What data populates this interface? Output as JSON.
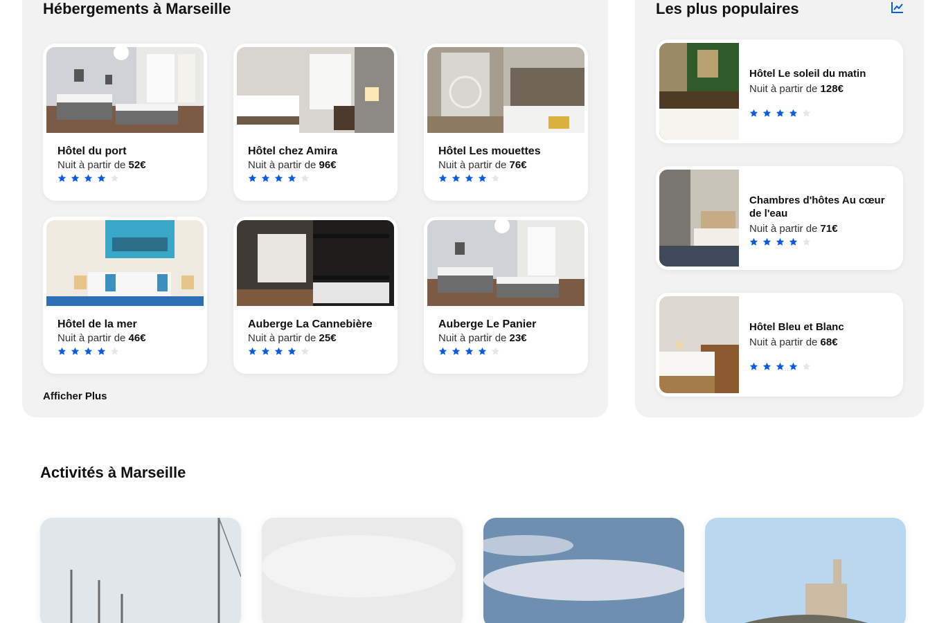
{
  "accommodations": {
    "title": "Hébergements à Marseille",
    "more_label": "Afficher Plus",
    "cards": [
      {
        "name": "Hôtel du port",
        "price_prefix": "Nuit à partir de ",
        "price": "52€",
        "rating": 4
      },
      {
        "name": "Hôtel chez Amira",
        "price_prefix": "Nuit à partir de ",
        "price": "96€",
        "rating": 4
      },
      {
        "name": "Hôtel Les mouettes",
        "price_prefix": "Nuit à partir de ",
        "price": "76€",
        "rating": 4
      },
      {
        "name": "Hôtel de la mer",
        "price_prefix": "Nuit à partir de ",
        "price": "46€",
        "rating": 4
      },
      {
        "name": "Auberge La Cannebière",
        "price_prefix": "Nuit à partir de ",
        "price": "25€",
        "rating": 4
      },
      {
        "name": "Auberge Le Panier",
        "price_prefix": "Nuit à partir de ",
        "price": "23€",
        "rating": 4
      }
    ]
  },
  "popular": {
    "title": "Les plus populaires",
    "icon": "chart-line-icon",
    "items": [
      {
        "name": "Hôtel Le soleil du matin",
        "price_prefix": "Nuit à partir de ",
        "price": "128€",
        "rating": 4
      },
      {
        "name": "Chambres d'hôtes Au cœur de l'eau",
        "price_prefix": "Nuit à partir de ",
        "price": "71€",
        "rating": 4
      },
      {
        "name": "Hôtel Bleu et Blanc",
        "price_prefix": "Nuit à partir de ",
        "price": "68€",
        "rating": 4
      }
    ]
  },
  "activities": {
    "title": "Activités à Marseille"
  },
  "colors": {
    "star_filled": "#0a5be0",
    "star_empty": "#e6e6e6",
    "panel_bg": "#f2f2f2"
  }
}
